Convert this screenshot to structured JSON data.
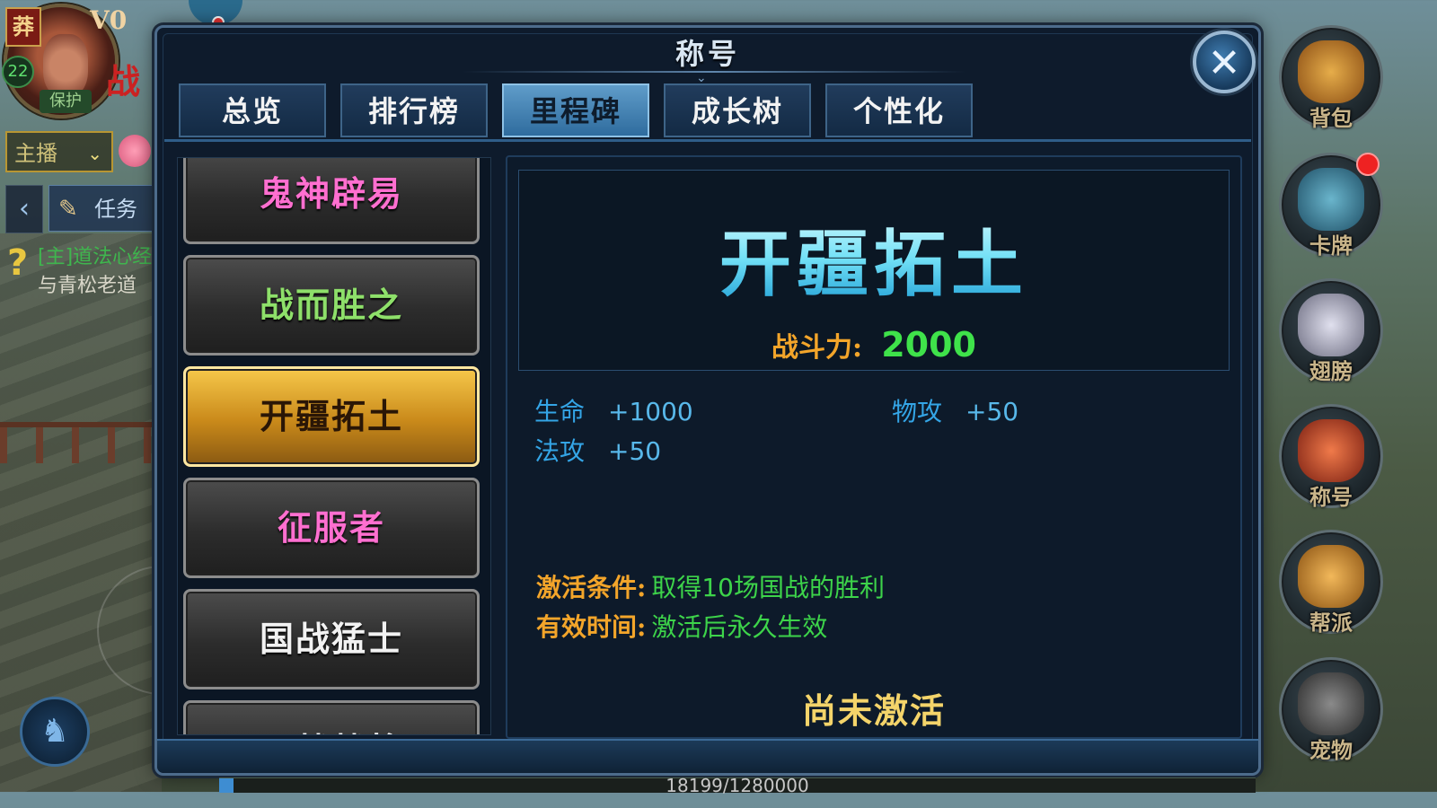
{
  "hud": {
    "tag": "莽",
    "vip": "V0",
    "level": "22",
    "protect": "保护",
    "banner_char": "战",
    "broadcast": "主播",
    "task": "任务",
    "quest_main": "[主]道法心经",
    "quest_sub": "与青松老道"
  },
  "side_menu": [
    {
      "label": "背包",
      "icon": "bag-icon",
      "color": "#d89a3a"
    },
    {
      "label": "卡牌",
      "icon": "cards-icon",
      "color": "#5a9fb6"
    },
    {
      "label": "翅膀",
      "icon": "wings-icon",
      "color": "#c9c9d8"
    },
    {
      "label": "称号",
      "icon": "title-icon",
      "color": "#d8543a"
    },
    {
      "label": "帮派",
      "icon": "guild-icon",
      "color": "#e0a24a"
    },
    {
      "label": "宠物",
      "icon": "pet-icon",
      "color": "#666666"
    }
  ],
  "dialog": {
    "title": "称号",
    "close": "✕",
    "tabs": [
      "总览",
      "排行榜",
      "里程碑",
      "成长树",
      "个性化"
    ],
    "active_tab": 2,
    "titles_list": [
      {
        "name": "鬼神辟易",
        "color": "#ff6fd0"
      },
      {
        "name": "战而胜之",
        "color": "#8ee06a"
      },
      {
        "name": "开疆拓土",
        "color": "#2a1606",
        "selected": true
      },
      {
        "name": "征服者",
        "color": "#ff6fd0"
      },
      {
        "name": "国战猛士",
        "color": "#f2f2f2"
      },
      {
        "name": "三战战将",
        "color": "#f2f2f2"
      }
    ],
    "detail": {
      "title": "开疆拓土",
      "power_label": "战斗力:",
      "power_value": "2000",
      "stats": [
        {
          "key": "生命",
          "value": "+1000"
        },
        {
          "key": "物攻",
          "value": "+50"
        },
        {
          "key": "法攻",
          "value": "+50"
        }
      ],
      "condition_label": "激活条件:",
      "condition_value": "取得10场国战的胜利",
      "duration_label": "有效时间:",
      "duration_value": "激活后永久生效",
      "status": "尚未激活"
    }
  },
  "exp": {
    "text": "18199/1280000",
    "progress": 0.0142
  }
}
